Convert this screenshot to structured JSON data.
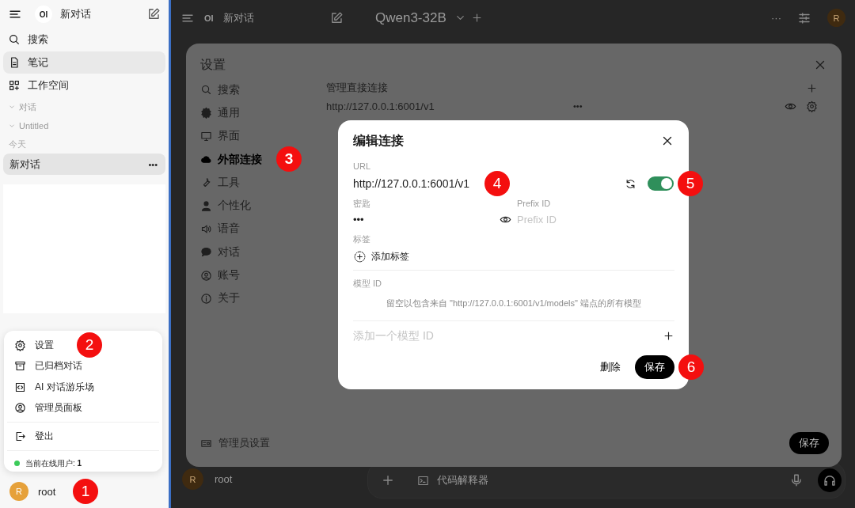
{
  "sidebar": {
    "logo": "OI",
    "title": "新对话",
    "nav": [
      {
        "label": "搜索",
        "kind": "search",
        "selected": false
      },
      {
        "label": "笔记",
        "kind": "note",
        "selected": true
      },
      {
        "label": "工作空间",
        "kind": "workspace",
        "selected": false
      }
    ],
    "folders": [
      "对话",
      "Untitled"
    ],
    "section": "今天",
    "chats": [
      {
        "title": "新对话",
        "selected": true,
        "more": "•••"
      }
    ],
    "user": {
      "initial": "R",
      "name": "root",
      "marker": "1"
    }
  },
  "user_menu": {
    "items": [
      {
        "label": "设置",
        "kind": "settings",
        "marker": "2"
      },
      {
        "label": "已归档对话",
        "kind": "archive"
      },
      {
        "label": "AI 对话游乐场",
        "kind": "code"
      },
      {
        "label": "管理员面板",
        "kind": "admin"
      },
      {
        "label": "登出",
        "kind": "logout"
      }
    ],
    "status": "当前在线用户: **1**"
  },
  "background": {
    "logo": "OI",
    "title": "新对话",
    "model": "Qwen3-32B",
    "more": "···",
    "avatar": "R",
    "user_initial": "R",
    "user_name": "root",
    "tool": "代码解释器"
  },
  "settings": {
    "title": "设置",
    "nav": [
      {
        "label": "搜索",
        "kind": "search",
        "selected": false
      },
      {
        "label": "通用",
        "kind": "gear",
        "selected": false
      },
      {
        "label": "界面",
        "kind": "monitor",
        "selected": false
      },
      {
        "label": "外部连接",
        "kind": "cloud",
        "selected": true,
        "marker": "3"
      },
      {
        "label": "工具",
        "kind": "wrench",
        "selected": false
      },
      {
        "label": "个性化",
        "kind": "person",
        "selected": false
      },
      {
        "label": "语音",
        "kind": "speaker",
        "selected": false
      },
      {
        "label": "对话",
        "kind": "chat",
        "selected": false
      },
      {
        "label": "账号",
        "kind": "account",
        "selected": false
      },
      {
        "label": "关于",
        "kind": "info",
        "selected": false
      }
    ],
    "admin": "管理员设置",
    "section_title": "管理直接连接",
    "connection": {
      "url": "http://127.0.0.1:6001/v1",
      "key": "•••"
    },
    "save": "保存"
  },
  "modal": {
    "title": "编辑连接",
    "url_label": "URL",
    "url": "http://127.0.0.1:6001/v1",
    "url_marker": "4",
    "enabled": true,
    "toggle_marker": "5",
    "key_label": "密匙",
    "key": "•••",
    "prefix_label": "Prefix ID",
    "prefix_placeholder": "Prefix ID",
    "tags_label": "标签",
    "add_tag": "添加标签",
    "model_label": "模型 ID",
    "model_hint": "留空以包含来自 \"http://127.0.0.1:6001/v1/models\" 端点的所有模型",
    "model_placeholder": "添加一个模型 ID",
    "delete": "删除",
    "save": "保存",
    "save_marker": "6"
  }
}
